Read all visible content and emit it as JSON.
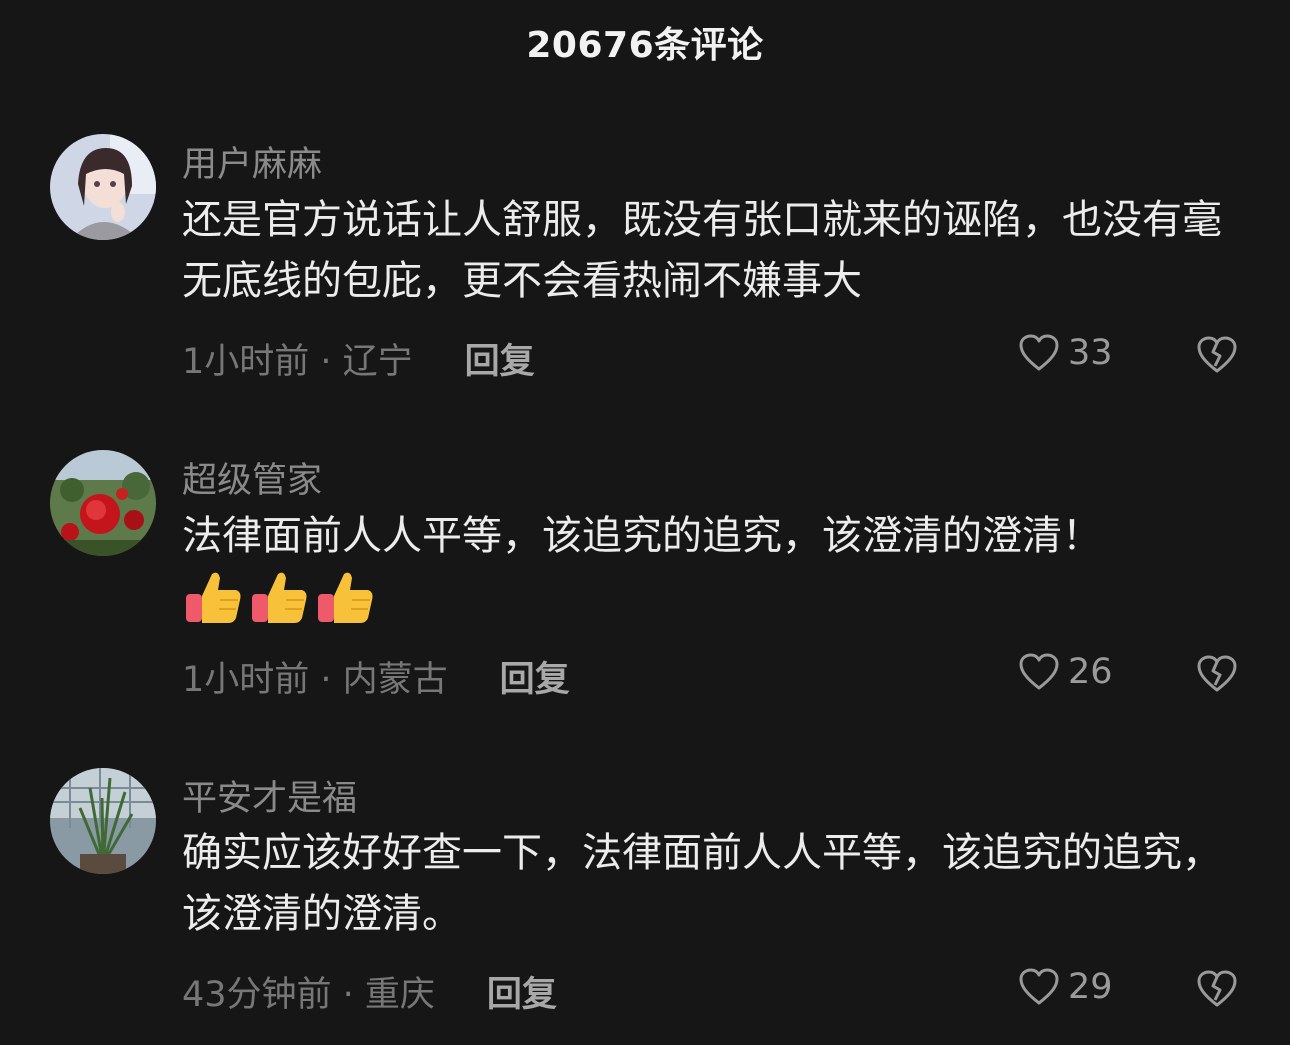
{
  "header": {
    "title": "20676条评论"
  },
  "comments": [
    {
      "username": "用户麻麻",
      "text": "还是官方说话让人舒服，既没有张口就来的诬陷，也没有毫无底线的包庇，更不会看热闹不嫌事大",
      "meta": "1小时前 · 辽宁",
      "reply": "回复",
      "likes": "33",
      "avatar": "anime-girl-avatar",
      "emojis": []
    },
    {
      "username": "超级管家",
      "text": "法律面前人人平等，该追究的追究，该澄清的澄清！",
      "meta": "1小时前 · 内蒙古",
      "reply": "回复",
      "likes": "26",
      "avatar": "red-rose-avatar",
      "emojis": [
        "thumbs-up",
        "thumbs-up",
        "thumbs-up"
      ]
    },
    {
      "username": "平安才是福",
      "text": "确实应该好好查一下，法律面前人人平等，该追究的追究，该澄清的澄清。",
      "meta": "43分钟前 · 重庆",
      "reply": "回复",
      "likes": "29",
      "avatar": "potted-plant-avatar",
      "emojis": []
    }
  ],
  "colors": {
    "background": "#161616",
    "username": "#8a8a8a",
    "text": "#ececec",
    "meta": "#777777"
  }
}
